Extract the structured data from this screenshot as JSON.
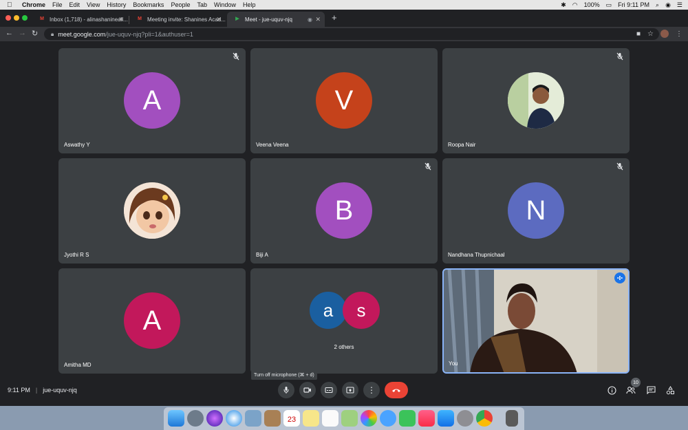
{
  "menubar": {
    "app": "Chrome",
    "items": [
      "File",
      "Edit",
      "View",
      "History",
      "Bookmarks",
      "People",
      "Tab",
      "Window",
      "Help"
    ],
    "battery": "100%",
    "clock": "Fri 9:11 PM"
  },
  "tabs": [
    {
      "label": "Inbox (1,718) - alinashanineali...",
      "favicon": "gmail-icon"
    },
    {
      "label": "Meeting invite: Shanines Acad...",
      "favicon": "gmail-icon"
    },
    {
      "label": "Meet - jue-uquv-njq",
      "favicon": "meet-icon"
    }
  ],
  "address": {
    "host": "meet.google.com",
    "path": "/jue-uquv-njq?pli=1&authuser=1"
  },
  "participants": [
    {
      "name": "Aswathy Y",
      "initial": "A",
      "color": "#a24fbf",
      "muted": true
    },
    {
      "name": "Veena Veena",
      "initial": "V",
      "color": "#c5421b",
      "muted": false
    },
    {
      "name": "Roopa Nair",
      "initial": "",
      "color": "#d8e0c8",
      "muted": true
    },
    {
      "name": "Jyothi R S",
      "initial": "",
      "color": "#e8c6a8",
      "muted": false
    },
    {
      "name": "Biji A",
      "initial": "B",
      "color": "#a24fbf",
      "muted": true
    },
    {
      "name": "Nandhana Thupnichaal",
      "initial": "N",
      "color": "#5c6bc0",
      "muted": true
    },
    {
      "name": "Amitha MD",
      "initial": "A",
      "color": "#c2185b",
      "muted": false
    }
  ],
  "others": {
    "label": "2 others",
    "a": "a",
    "s": "s",
    "a_color": "#1a5fa0",
    "s_color": "#c2185b"
  },
  "you": {
    "label": "You"
  },
  "footer": {
    "time": "9:11 PM",
    "code": "jue-uquv-njq",
    "tooltip": "Turn off microphone (⌘ + d)",
    "participant_count": "10"
  }
}
